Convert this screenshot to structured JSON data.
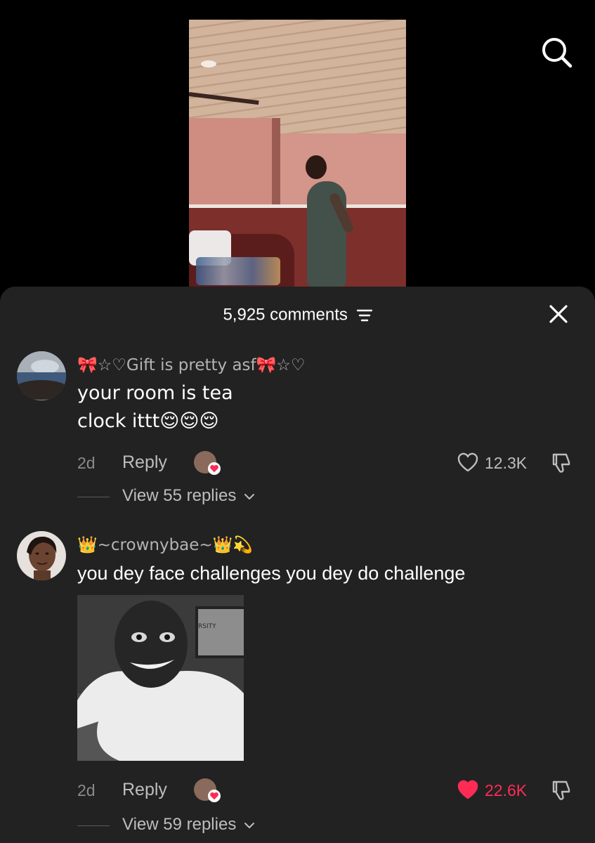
{
  "comments_header": {
    "count_label": "5,925 comments"
  },
  "comments": [
    {
      "username": "🎀☆♡Gift is pretty asf🎀☆♡",
      "text_lines": [
        "your room is tea",
        "clock ittt😌😌😌"
      ],
      "time": "2d",
      "reply_label": "Reply",
      "likes": "12.3K",
      "liked": false,
      "view_replies": "View 55 replies"
    },
    {
      "username": "👑~crownybae~👑💫",
      "text_lines": [
        "you dey face challenges you dey do challenge"
      ],
      "time": "2d",
      "reply_label": "Reply",
      "likes": "22.6K",
      "liked": true,
      "view_replies": "View 59 replies"
    }
  ],
  "gif_watermark": "RSITY",
  "colors": {
    "sheet_bg": "#222222",
    "liked_red": "#fe2c55",
    "secondary_text": "#bdbdbd"
  },
  "icons": {
    "search": "search-icon",
    "close": "close-icon",
    "filter": "filter-icon",
    "like": "heart-icon",
    "dislike": "thumbs-down-icon"
  }
}
